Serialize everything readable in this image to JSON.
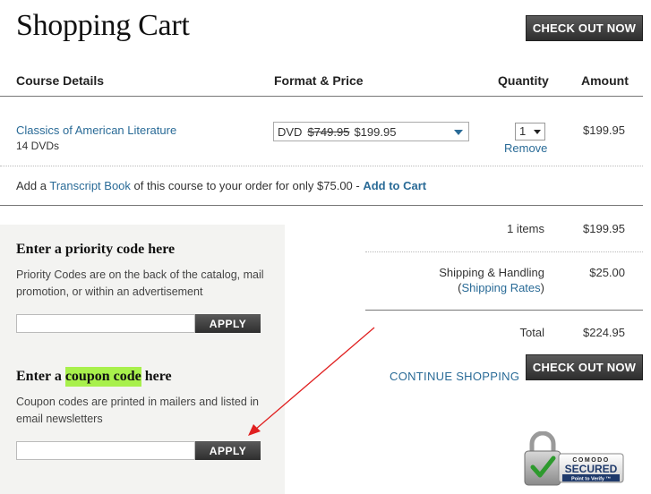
{
  "header": {
    "title": "Shopping Cart",
    "checkout_label": "CHECK OUT NOW"
  },
  "columns": {
    "course": "Course Details",
    "format": "Format & Price",
    "quantity": "Quantity",
    "amount": "Amount"
  },
  "cart_item": {
    "title": "Classics of American Literature",
    "subtitle": "14 DVDs",
    "format": "DVD",
    "original_price": "$749.95",
    "sale_price": "$199.95",
    "quantity": "1",
    "remove_label": "Remove",
    "amount": "$199.95"
  },
  "transcript": {
    "prefix": "Add a ",
    "link": "Transcript Book",
    "middle": " of this course to your order for only $75.00 - ",
    "action": "Add to Cart"
  },
  "priority": {
    "heading": "Enter a priority code here",
    "description": "Priority Codes are on the back of the catalog, mail promotion, or within an advertisement",
    "input_value": "",
    "apply_label": "APPLY"
  },
  "coupon": {
    "heading_before": "Enter a ",
    "heading_highlight": "coupon code",
    "heading_after": " here",
    "description": "Coupon codes are printed in mailers and listed in email newsletters",
    "input_value": "",
    "apply_label": "APPLY"
  },
  "summary": {
    "items_label": "1 items",
    "items_amount": "$199.95",
    "shipping_label": "Shipping & Handling",
    "shipping_paren_open": "(",
    "shipping_rates_link": "Shipping Rates",
    "shipping_paren_close": ")",
    "shipping_amount": "$25.00",
    "total_label": "Total",
    "total_amount": "$224.95"
  },
  "footer": {
    "continue_label": "CONTINUE SHOPPING",
    "checkout_label": "CHECK OUT NOW"
  },
  "seal": {
    "brand": "COMODO",
    "status": "SECURED",
    "tagline": "Point to Verify ™"
  },
  "colors": {
    "link": "#2a6b97",
    "highlight": "#a8f04c",
    "annotation_arrow": "#e02020",
    "panel_bg": "#f3f3f1"
  }
}
